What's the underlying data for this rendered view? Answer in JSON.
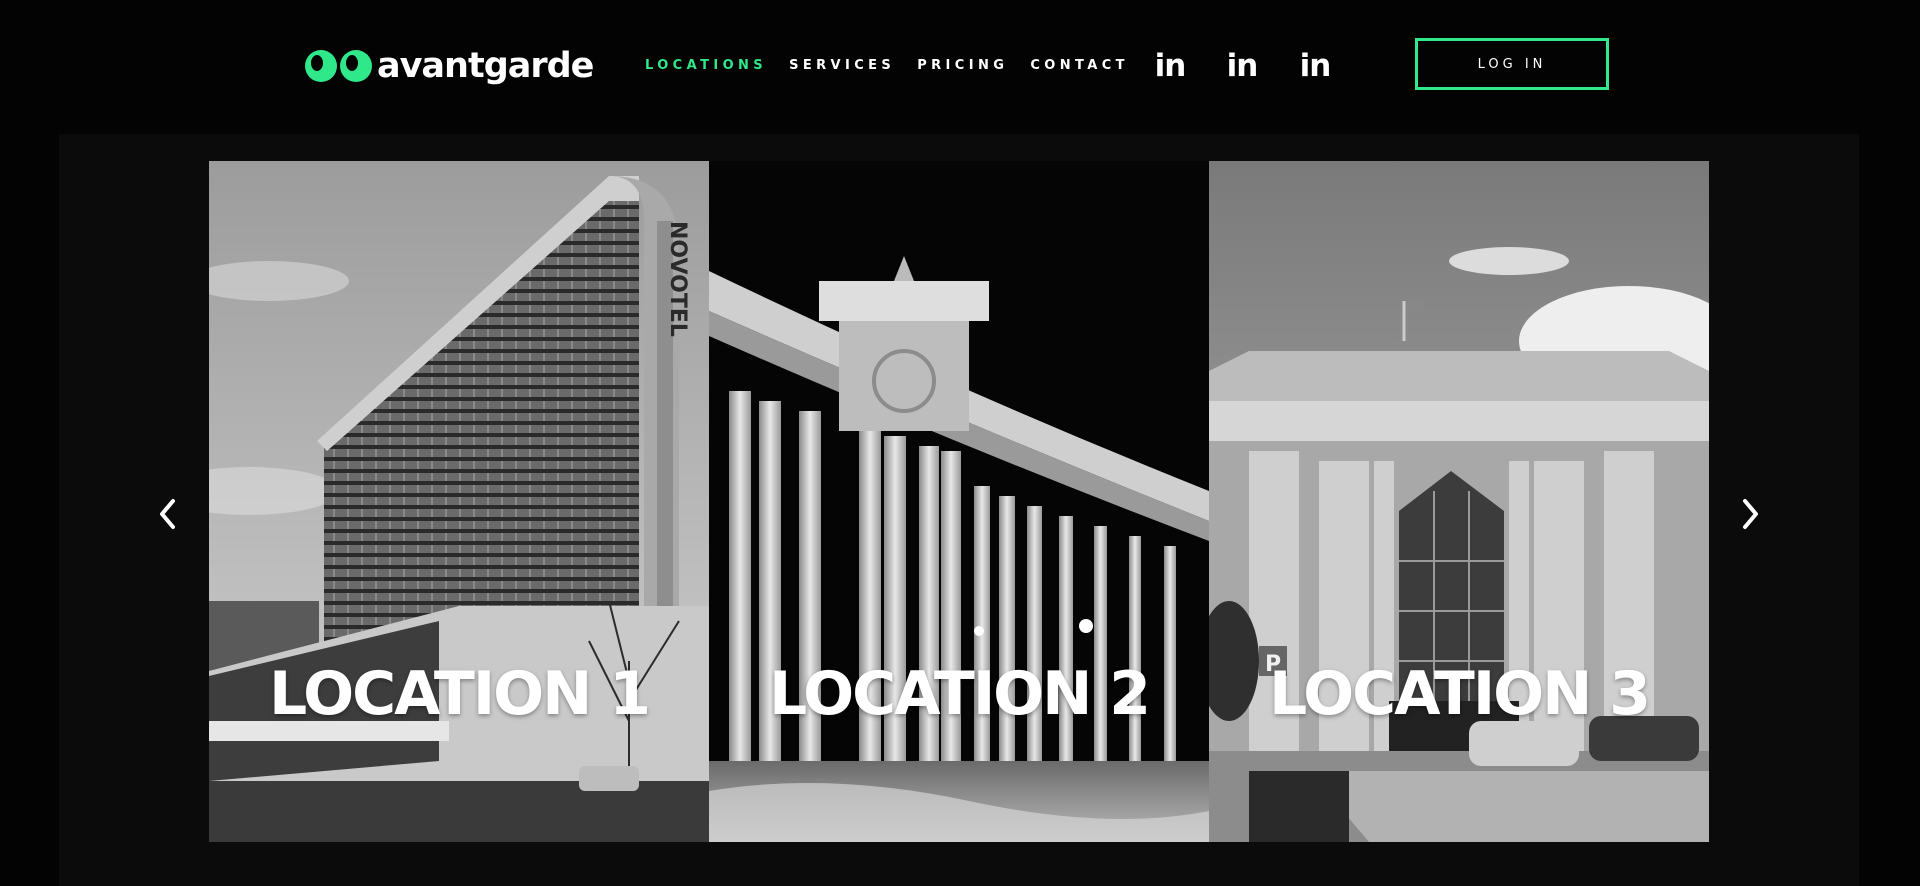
{
  "brand": {
    "name": "avantgarde",
    "accent": "#2ee88a"
  },
  "nav": [
    {
      "label": "LOCATIONS",
      "active": true
    },
    {
      "label": "SERVICES",
      "active": false
    },
    {
      "label": "PRICING",
      "active": false
    },
    {
      "label": "CONTACT",
      "active": false
    }
  ],
  "social": [
    {
      "icon": "linkedin-icon",
      "label": "in"
    },
    {
      "icon": "linkedin-icon",
      "label": "in"
    },
    {
      "icon": "linkedin-icon",
      "label": "in"
    }
  ],
  "login_label": "LOG IN",
  "carousel": {
    "prev_icon": "chevron-left-icon",
    "next_icon": "chevron-right-icon",
    "slides": [
      {
        "title": "LOCATION 1",
        "signage": "NOVOTEL"
      },
      {
        "title": "LOCATION 2"
      },
      {
        "title": "LOCATION 3",
        "signage": "P"
      }
    ]
  }
}
